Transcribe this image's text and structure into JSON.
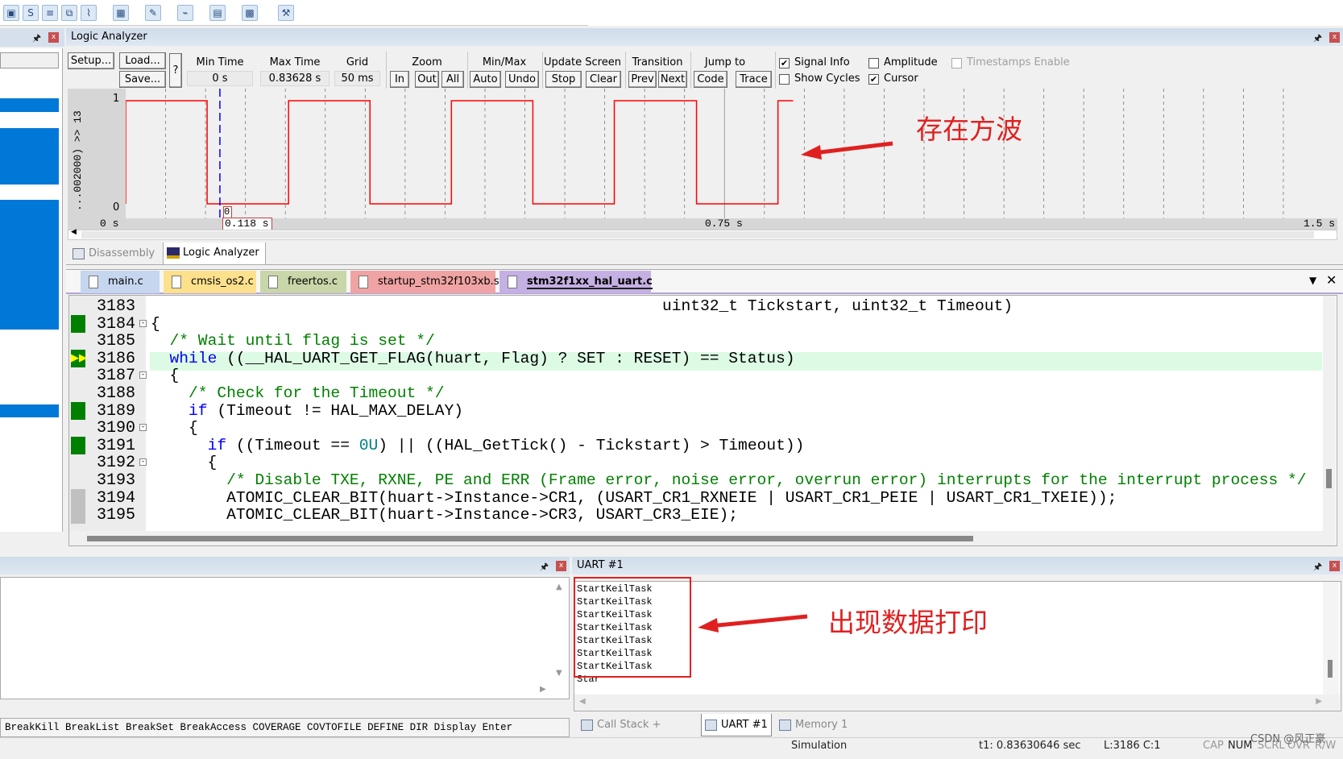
{
  "toolbar": {
    "icons": [
      "debug-window-icon",
      "serial-window-icon",
      "registers-icon",
      "memory-icon",
      "analysis-icon",
      "watch-icon",
      "trace-icon",
      "logic-analyzer-icon",
      "system-viewer-icon",
      "toolbox-icon",
      "tools-icon"
    ]
  },
  "logic_analyzer": {
    "title": "Logic Analyzer",
    "setup": "Setup...",
    "load": "Load...",
    "save": "Save...",
    "help": "?",
    "min_time_label": "Min Time",
    "min_time": "0 s",
    "max_time_label": "Max Time",
    "max_time": "0.83628 s",
    "grid_label": "Grid",
    "grid": "50 ms",
    "zoom_label": "Zoom",
    "zoom_in": "In",
    "zoom_out": "Out",
    "zoom_all": "All",
    "minmax_label": "Min/Max",
    "auto": "Auto",
    "undo": "Undo",
    "update_label": "Update Screen",
    "stop": "Stop",
    "clear": "Clear",
    "transition_label": "Transition",
    "prev": "Prev",
    "next": "Next",
    "jump_label": "Jump to",
    "code": "Code",
    "trace": "Trace",
    "signal_info": "Signal Info",
    "signal_info_checked": true,
    "show_cycles": "Show Cycles",
    "show_cycles_checked": false,
    "amplitude": "Amplitude",
    "amplitude_checked": false,
    "cursor": "Cursor",
    "cursor_checked": true,
    "timestamps": "Timestamps Enable",
    "timestamps_checked": false,
    "signal_name": "...002000) >> 13",
    "y_max": "1",
    "y_min": "0",
    "cursor_value": "0",
    "axis_start": "0 s",
    "cursor_time": "0.118 s",
    "axis_mid": "0.75 s",
    "axis_end": "1.5 s",
    "waveform": {
      "x_range_s": [
        0,
        1.5
      ],
      "grid_s": 0.05,
      "cursor_s": 0.118,
      "start_level": 1,
      "end_s": 0.836,
      "transitions_s": [
        0.102,
        0.204,
        0.306,
        0.408,
        0.51,
        0.612,
        0.715,
        0.817
      ],
      "color": "#ff0000",
      "cursor_color": "#0000ff"
    }
  },
  "annotation_top": "存在方波",
  "annotation_bottom": "出现数据打印",
  "view_tabs": [
    {
      "label": "Disassembly"
    },
    {
      "label": "Logic Analyzer"
    }
  ],
  "file_tabs": [
    {
      "label": "main.c",
      "color": "#c6d6ee"
    },
    {
      "label": "cmsis_os2.c",
      "color": "#fce08c"
    },
    {
      "label": "freertos.c",
      "color": "#c9d6a9"
    },
    {
      "label": "startup_stm32f103xb.s",
      "color": "#f0a3a3"
    },
    {
      "label": "stm32f1xx_hal_uart.c",
      "color": "#c4b0e2"
    }
  ],
  "code": {
    "current_line": "3186",
    "lines": [
      {
        "n": "3183",
        "text": "                                                      uint32_t Tickstart, uint32_t Timeout)",
        "mark": ""
      },
      {
        "n": "3184",
        "text": "{",
        "mark": "exec"
      },
      {
        "n": "3185",
        "text": "  /* Wait until flag is set */",
        "mark": ""
      },
      {
        "n": "3186",
        "text": "  while ((__HAL_UART_GET_FLAG(huart, Flag) ? SET : RESET) == Status)",
        "mark": "current"
      },
      {
        "n": "3187",
        "text": "  {",
        "mark": ""
      },
      {
        "n": "3188",
        "text": "    /* Check for the Timeout */",
        "mark": ""
      },
      {
        "n": "3189",
        "text": "    if (Timeout != HAL_MAX_DELAY)",
        "mark": "exec"
      },
      {
        "n": "3190",
        "text": "    {",
        "mark": ""
      },
      {
        "n": "3191",
        "text": "      if ((Timeout == 0U) || ((HAL_GetTick() - Tickstart) > Timeout))",
        "mark": "exec"
      },
      {
        "n": "3192",
        "text": "      {",
        "mark": ""
      },
      {
        "n": "3193",
        "text": "        /* Disable TXE, RXNE, PE and ERR (Frame error, noise error, overrun error) interrupts for the interrupt process */",
        "mark": ""
      },
      {
        "n": "3194",
        "text": "        ATOMIC_CLEAR_BIT(huart->Instance->CR1, (USART_CR1_RXNEIE | USART_CR1_PEIE | USART_CR1_TXEIE));",
        "mark": "gray"
      },
      {
        "n": "3195",
        "text": "        ATOMIC_CLEAR_BIT(huart->Instance->CR3, USART_CR3_EIE);",
        "mark": "gray"
      }
    ]
  },
  "uart": {
    "title": "UART #1",
    "lines": [
      "StartKeilTask",
      "StartKeilTask",
      "StartKeilTask",
      "StartKeilTask",
      "StartKeilTask",
      "StartKeilTask",
      "StartKeilTask",
      "Star"
    ]
  },
  "command": {
    "hint": "BreakKill BreakList BreakSet BreakAccess COVERAGE COVTOFILE DEFINE DIR Display Enter"
  },
  "bottom_tabs": [
    {
      "label": "Call Stack + Locals"
    },
    {
      "label": "UART #1"
    },
    {
      "label": "Memory 1"
    }
  ],
  "status": {
    "mode": "Simulation",
    "time": "t1: 0.83630646 sec",
    "position": "L:3186 C:1",
    "cap": "CAP",
    "num": "NUM",
    "scrl": "SCRL",
    "ovr": "OVR",
    "rw": "R/W"
  },
  "watermark": "CSDN @风正豪"
}
